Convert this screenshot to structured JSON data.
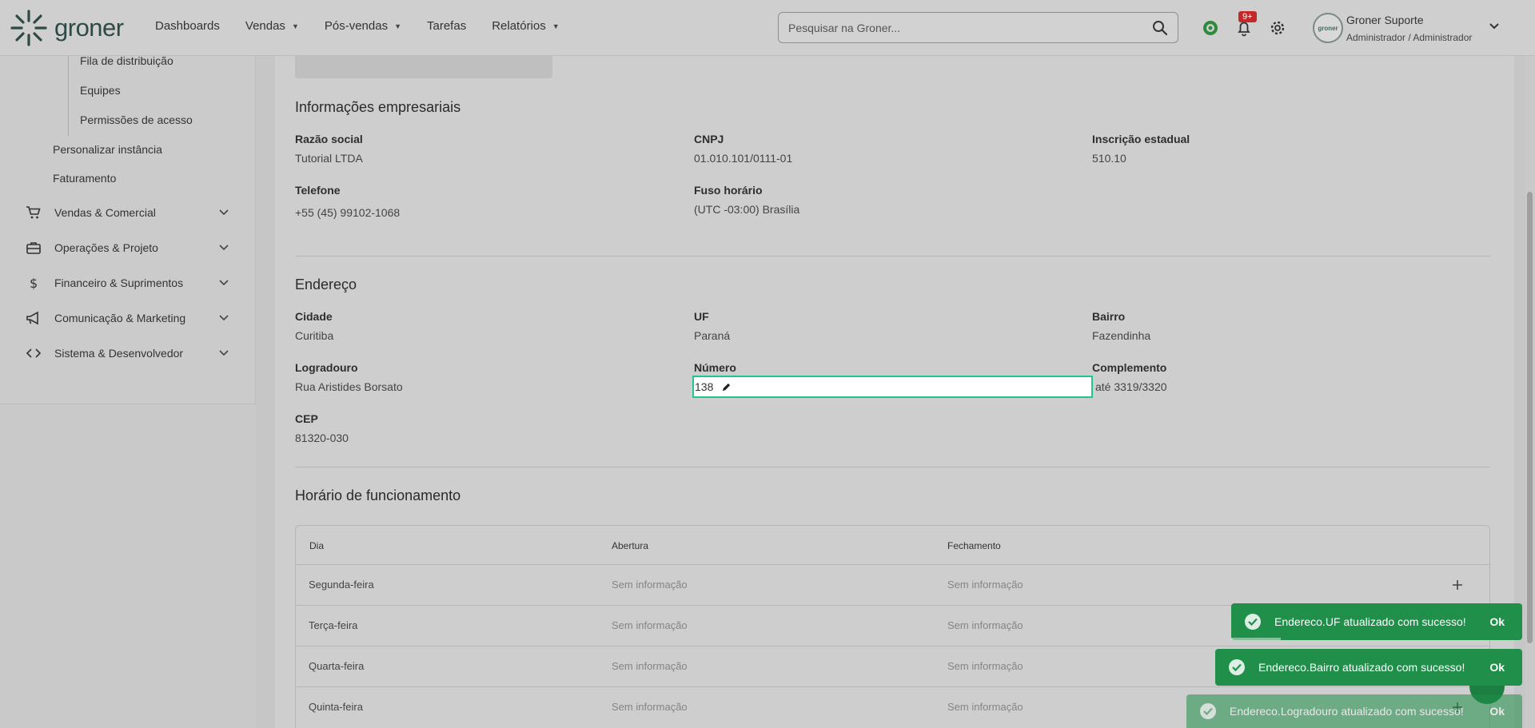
{
  "brand": {
    "name": "groner",
    "color": "#2d4a45"
  },
  "nav": {
    "items": [
      {
        "label": "Dashboards",
        "has_menu": false
      },
      {
        "label": "Vendas",
        "has_menu": true
      },
      {
        "label": "Pós-vendas",
        "has_menu": true
      },
      {
        "label": "Tarefas",
        "has_menu": false
      },
      {
        "label": "Relatórios",
        "has_menu": true
      }
    ]
  },
  "search": {
    "placeholder": "Pesquisar na Groner..."
  },
  "notifications": {
    "badge": "9+"
  },
  "user": {
    "name": "Groner Suporte",
    "role": "Administrador / Administrador",
    "avatar_text": "groner"
  },
  "sidebar": {
    "sub_items": [
      "Fila de distribuição",
      "Equipes",
      "Permissões de acesso"
    ],
    "items": [
      "Personalizar instância",
      "Faturamento"
    ],
    "groups": [
      {
        "label": "Vendas & Comercial",
        "icon": "cart-icon"
      },
      {
        "label": "Operações & Projeto",
        "icon": "briefcase-icon"
      },
      {
        "label": "Financeiro & Suprimentos",
        "icon": "dollar-icon"
      },
      {
        "label": "Comunicação & Marketing",
        "icon": "megaphone-icon"
      },
      {
        "label": "Sistema & Desenvolvedor",
        "icon": "code-icon"
      }
    ]
  },
  "company": {
    "title": "Informações empresariais",
    "razao_social": {
      "label": "Razão social",
      "value": "Tutorial LTDA"
    },
    "cnpj": {
      "label": "CNPJ",
      "value": "01.010.101/0111-01"
    },
    "ie": {
      "label": "Inscrição estadual",
      "value": "510.10"
    },
    "telefone": {
      "label": "Telefone",
      "value": "+55 (45) 99102-1068"
    },
    "fuso": {
      "label": "Fuso horário",
      "value": "(UTC -03:00) Brasília"
    }
  },
  "address": {
    "title": "Endereço",
    "cidade": {
      "label": "Cidade",
      "value": "Curitiba"
    },
    "uf": {
      "label": "UF",
      "value": "Paraná"
    },
    "bairro": {
      "label": "Bairro",
      "value": "Fazendinha"
    },
    "logradouro": {
      "label": "Logradouro",
      "value": "Rua Aristides Borsato"
    },
    "numero": {
      "label": "Número",
      "value": "138"
    },
    "complemento": {
      "label": "Complemento",
      "value": "até 3319/3320"
    },
    "cep": {
      "label": "CEP",
      "value": "81320-030"
    }
  },
  "hours": {
    "title": "Horário de funcionamento",
    "columns": [
      "Dia",
      "Abertura",
      "Fechamento"
    ],
    "rows": [
      {
        "day": "Segunda-feira",
        "open": "Sem informação",
        "close": "Sem informação"
      },
      {
        "day": "Terça-feira",
        "open": "Sem informação",
        "close": "Sem informação"
      },
      {
        "day": "Quarta-feira",
        "open": "Sem informação",
        "close": "Sem informação"
      },
      {
        "day": "Quinta-feira",
        "open": "Sem informação",
        "close": "Sem informação"
      }
    ]
  },
  "toasts": [
    {
      "message": "Endereco.UF atualizado com sucesso!",
      "ok": "Ok",
      "progress": 0.17
    },
    {
      "message": "Endereco.Bairro atualizado com sucesso!",
      "ok": "Ok",
      "progress": 0
    },
    {
      "message": "Endereco.Logradouro atualizado com sucesso!",
      "ok": "Ok",
      "progress": 0
    }
  ],
  "colors": {
    "accent": "#22c58a",
    "toast": "#1f8f4a",
    "badge": "#c62828"
  }
}
